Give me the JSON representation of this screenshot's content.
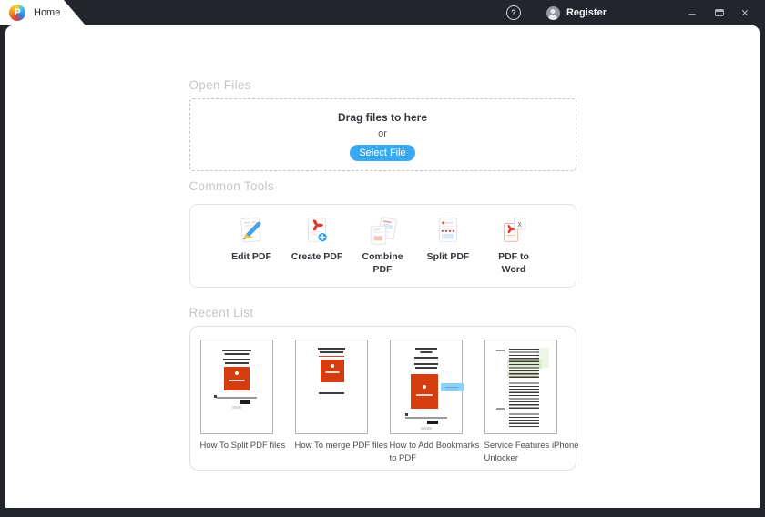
{
  "titlebar": {
    "tab": "Home",
    "help_icon": "?",
    "register": "Register",
    "window": {
      "minimize": "–",
      "close": "✕"
    }
  },
  "colors": {
    "titlebar_bg": "#22252b",
    "accent_blue": "#38a8f0",
    "brand_red": "#d63d0e",
    "section_title_gray": "#c6c6c6",
    "highlight_green": "#dcead0"
  },
  "open_files": {
    "title": "Open Files",
    "drag_text": "Drag files to here",
    "or_text": "or",
    "select_button": "Select File"
  },
  "common_tools": {
    "title": "Common Tools",
    "tools": [
      {
        "label": "Edit PDF",
        "icon": "edit-pdf-icon"
      },
      {
        "label": "Create PDF",
        "icon": "create-pdf-icon"
      },
      {
        "label": "Combine PDF",
        "icon": "combine-pdf-icon"
      },
      {
        "label": "Split PDF",
        "icon": "split-pdf-icon"
      },
      {
        "label": "PDF to Word",
        "icon": "pdf-to-word-icon"
      }
    ]
  },
  "recent_list": {
    "title": "Recent List",
    "items": [
      {
        "label": "How To Split PDF files",
        "thumb": "split-doc"
      },
      {
        "label": "How To merge PDF files",
        "thumb": "merge-doc"
      },
      {
        "label": "How to Add Bookmarks to PDF",
        "thumb": "bookmarks-doc"
      },
      {
        "label": "Service Features iPhone Unlocker",
        "thumb": "toc-doc"
      }
    ]
  }
}
